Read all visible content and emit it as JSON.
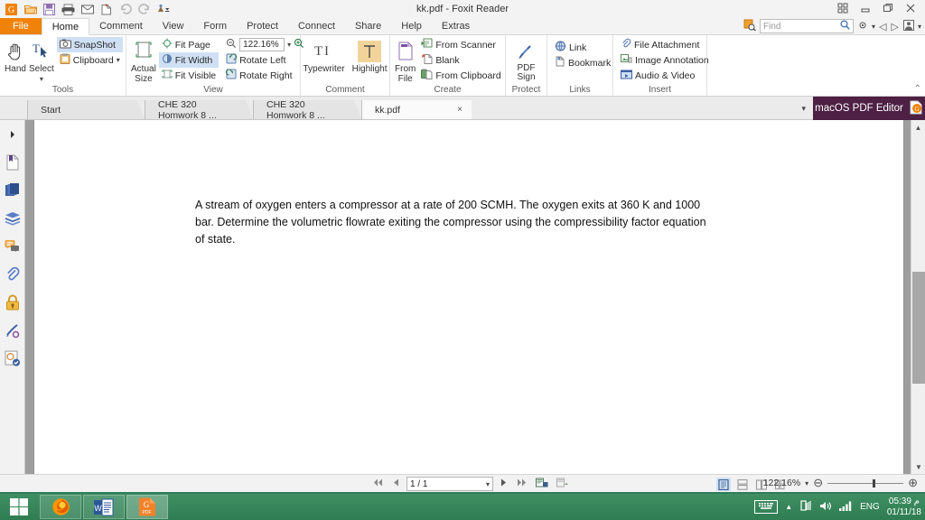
{
  "window": {
    "title": "kk.pdf - Foxit Reader",
    "quick_access": [
      "foxit-logo-icon",
      "open-icon",
      "save-icon",
      "print-icon",
      "email-icon",
      "new-icon",
      "undo-icon",
      "redo-icon",
      "customize-icon"
    ],
    "controls": [
      "restore-grid-icon",
      "minimize-icon",
      "maximize-icon",
      "close-icon"
    ]
  },
  "menu": {
    "file_label": "File",
    "items": [
      {
        "label": "Home",
        "active": true
      },
      {
        "label": "Comment",
        "active": false
      },
      {
        "label": "View",
        "active": false
      },
      {
        "label": "Form",
        "active": false
      },
      {
        "label": "Protect",
        "active": false
      },
      {
        "label": "Connect",
        "active": false
      },
      {
        "label": "Share",
        "active": false
      },
      {
        "label": "Help",
        "active": false
      },
      {
        "label": "Extras",
        "active": false
      }
    ]
  },
  "find": {
    "placeholder": "Find",
    "value": ""
  },
  "ribbon": {
    "groups": [
      {
        "label": "Tools",
        "big": [
          {
            "label": "Hand",
            "icon": "hand-icon"
          },
          {
            "label": "Select",
            "icon": "select-text-icon"
          }
        ],
        "small": [
          {
            "label": "SnapShot",
            "icon": "camera-icon",
            "selected": true
          },
          {
            "label": "Clipboard",
            "icon": "clipboard-icon",
            "selected": false
          }
        ]
      },
      {
        "label": "View",
        "big": [
          {
            "label": "Actual Size",
            "icon": "actual-size-icon"
          }
        ],
        "small": [
          {
            "label": "Fit Page",
            "icon": "fit-page-icon",
            "selected": false
          },
          {
            "label": "Fit Width",
            "icon": "fit-width-icon",
            "selected": true
          },
          {
            "label": "Fit Visible",
            "icon": "fit-visible-icon",
            "selected": false
          },
          {
            "label": "Rotate Left",
            "icon": "rotate-left-icon",
            "selected": false
          },
          {
            "label": "Rotate Right",
            "icon": "rotate-right-icon",
            "selected": false
          }
        ],
        "zoom_value": "122.16%"
      },
      {
        "label": "Comment",
        "big": [
          {
            "label": "Typewriter",
            "icon": "typewriter-icon"
          },
          {
            "label": "Highlight",
            "icon": "highlight-icon"
          }
        ],
        "small": []
      },
      {
        "label": "Create",
        "big": [
          {
            "label": "From File",
            "icon": "from-file-icon"
          }
        ],
        "small": [
          {
            "label": "From Scanner",
            "icon": "scanner-icon",
            "selected": false
          },
          {
            "label": "Blank",
            "icon": "blank-page-icon",
            "selected": false
          },
          {
            "label": "From Clipboard",
            "icon": "clipboard-page-icon",
            "selected": false
          }
        ]
      },
      {
        "label": "Protect",
        "big": [
          {
            "label": "PDF Sign",
            "icon": "pdf-sign-icon"
          }
        ],
        "small": []
      },
      {
        "label": "Links",
        "big": [],
        "small": [
          {
            "label": "Link",
            "icon": "link-icon",
            "selected": false
          },
          {
            "label": "Bookmark",
            "icon": "bookmark-icon",
            "selected": false
          }
        ]
      },
      {
        "label": "Insert",
        "big": [],
        "small": [
          {
            "label": "File Attachment",
            "icon": "attachment-icon",
            "selected": false
          },
          {
            "label": "Image Annotation",
            "icon": "image-annotation-icon",
            "selected": false
          },
          {
            "label": "Audio & Video",
            "icon": "audio-video-icon",
            "selected": false
          }
        ]
      }
    ]
  },
  "tabs": {
    "items": [
      {
        "label": "Start",
        "active": false,
        "closable": false
      },
      {
        "label": "CHE 320 Homwork 8 ...",
        "active": false,
        "closable": false
      },
      {
        "label": "CHE 320 Homwork 8 ...",
        "active": false,
        "closable": false
      },
      {
        "label": "kk.pdf",
        "active": true,
        "closable": true
      }
    ],
    "close_glyph": "×",
    "overflow_glyph": "▾"
  },
  "badge": {
    "label": "macOS PDF Editor",
    "icon": "foxit-pdf-icon",
    "color": "#4d2044"
  },
  "sidebar": {
    "items": [
      {
        "name": "expand-panel-icon",
        "label": "Expand"
      },
      {
        "name": "bookmarks-icon",
        "label": "Bookmarks"
      },
      {
        "name": "pages-icon",
        "label": "Page Thumbnails"
      },
      {
        "name": "layers-icon",
        "label": "Layers"
      },
      {
        "name": "comments-icon",
        "label": "Comments"
      },
      {
        "name": "attachments-icon",
        "label": "Attachments"
      },
      {
        "name": "security-lock-icon",
        "label": "Security"
      },
      {
        "name": "signatures-icon",
        "label": "Digital Signatures"
      },
      {
        "name": "stamp-icon",
        "label": "Stamps"
      }
    ]
  },
  "document": {
    "paragraph": "A stream of oxygen enters a compressor at a rate of 200 SCMH.  The oxygen exits at 360 K and 1000 bar. Determine the volumetric flowrate exiting the compressor using the compressibility factor equation of state."
  },
  "status": {
    "page_value": "1 / 1",
    "first_glyph": "⏮",
    "prev_glyph": "◀",
    "next_glyph": "▶",
    "last_glyph": "⏭",
    "zoom_value": "122.16%",
    "zoom_out_glyph": "⊖",
    "zoom_in_glyph": "⊕",
    "view_modes": [
      {
        "name": "single-page-mode",
        "glyph": "▤",
        "selected": true
      },
      {
        "name": "continuous-mode",
        "glyph": "≣",
        "selected": false
      },
      {
        "name": "facing-mode",
        "glyph": "▥",
        "selected": false
      },
      {
        "name": "continuous-facing-mode",
        "glyph": "≡",
        "selected": false
      }
    ],
    "extra_buttons": [
      {
        "name": "rotate-view-button",
        "glyph": "⎘"
      },
      {
        "name": "page-transition-button",
        "glyph": "⎙"
      }
    ]
  },
  "taskbar": {
    "start_label": "Start",
    "items": [
      {
        "name": "taskbar-firefox",
        "label": "Firefox",
        "active": false
      },
      {
        "name": "taskbar-word",
        "label": "Word",
        "active": false
      },
      {
        "name": "taskbar-foxit",
        "label": "Foxit Reader",
        "active": true
      }
    ],
    "tray": {
      "keyboard_icon": "keyboard-icon",
      "chevron": "▲",
      "network_icon": "network-icon",
      "volume_icon": "volume-icon",
      "signal_icon": "signal-icon",
      "language": "ENG",
      "time": "05:39 م",
      "date": "01/11/18"
    }
  }
}
